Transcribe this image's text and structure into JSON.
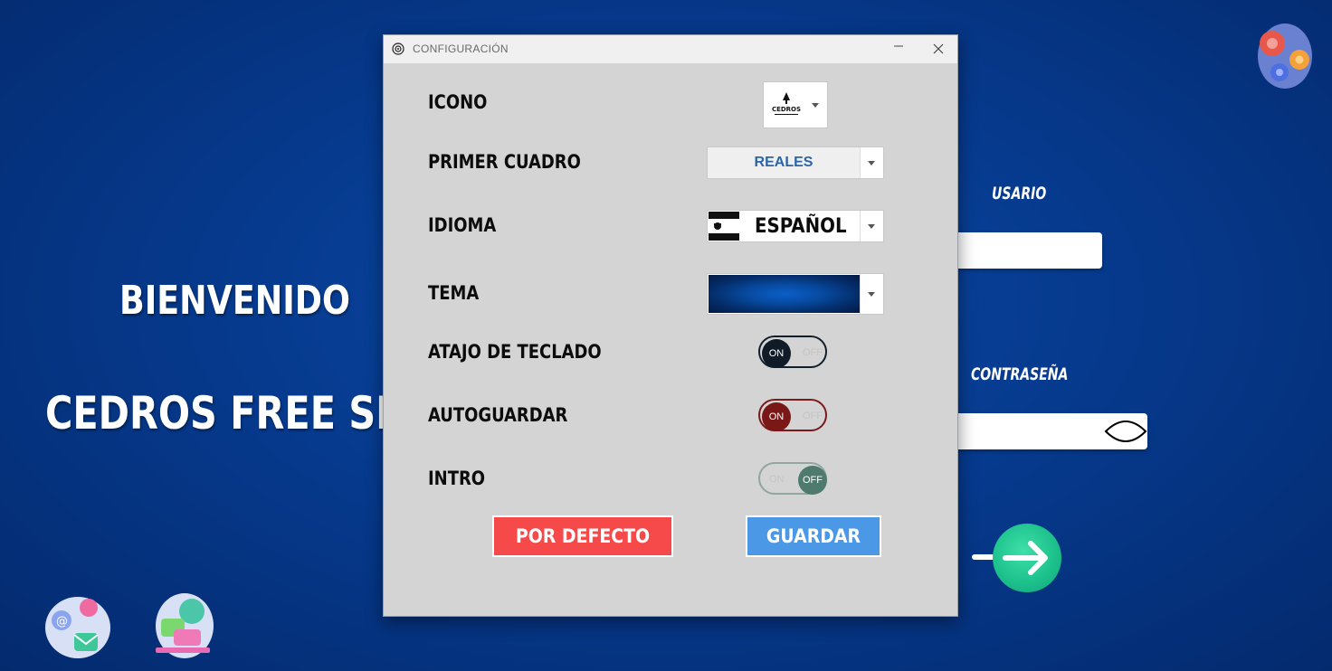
{
  "background": {
    "welcome_title": "BIENVENIDO",
    "shop_title": "CEDROS FREE SHOP",
    "login": {
      "user_label": "USARIO",
      "user_value": "",
      "password_label": "CONTRASEÑA",
      "password_value": ""
    }
  },
  "dialog": {
    "title": "CONFIGURACIÓN",
    "rows": [
      {
        "label": "ICONO"
      },
      {
        "label": "PRIMER CUADRO",
        "value": "REALES"
      },
      {
        "label": "IDIOMA",
        "value": "ESPAÑOL"
      },
      {
        "label": "TEMA"
      },
      {
        "label": "ATAJO DE TECLADO",
        "state": "ON"
      },
      {
        "label": "AUTOGUARDAR",
        "state": "ON"
      },
      {
        "label": "INTRO",
        "state": "OFF"
      }
    ],
    "toggle_on_text": "ON",
    "toggle_off_text": "OFF",
    "icon_preview_text": "CEDROS",
    "default_button": "POR DEFECTO",
    "save_button": "GUARDAR"
  },
  "colors": {
    "background": "#063a8e",
    "default_button": "#f64a4a",
    "save_button": "#4a98e6",
    "accent_go": "#1bbf8a"
  }
}
